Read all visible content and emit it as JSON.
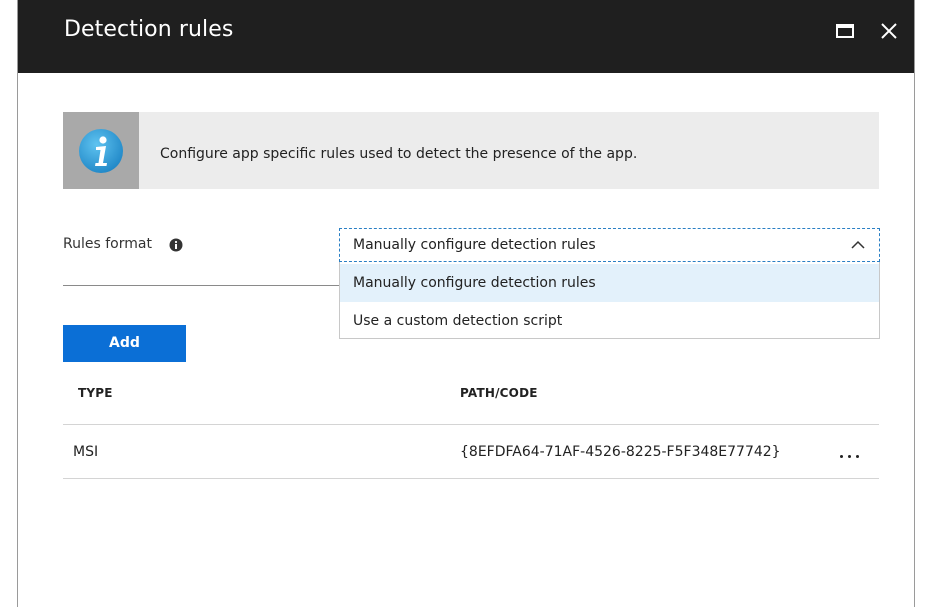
{
  "window": {
    "title": "Detection rules",
    "icons": {
      "maximize": "maximize-icon",
      "close": "close-icon"
    }
  },
  "info_banner": {
    "icon": "info-icon",
    "text": "Configure app specific rules used to detect the presence of the app."
  },
  "rules_format": {
    "label": "Rules format",
    "info_icon": "info-circle-icon",
    "selected": "Manually configure detection rules",
    "expanded": true,
    "options": [
      {
        "label": "Manually configure detection rules",
        "highlighted": true
      },
      {
        "label": "Use a custom detection script",
        "highlighted": false
      }
    ]
  },
  "add_button": {
    "label": "Add"
  },
  "table": {
    "columns": [
      "TYPE",
      "PATH/CODE"
    ],
    "rows": [
      {
        "type": "MSI",
        "path": "{8EFDFA64-71AF-4526-8225-F5F348E77742}",
        "menu_icon": "ellipsis-icon"
      }
    ]
  },
  "colors": {
    "titlebar": "#1f1f1f",
    "accent": "#0b6fd6",
    "info_icon": "#2e9fd8",
    "banner_bg": "#ececec",
    "highlight": "#e3f1fb"
  }
}
